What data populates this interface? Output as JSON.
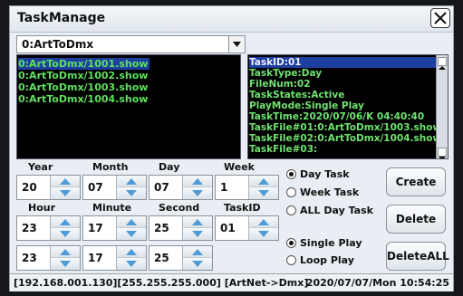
{
  "window": {
    "title": "TaskManage",
    "close_icon": "close-x-icon"
  },
  "task_selector": {
    "value": "0:ArtToDmx",
    "dropdown_icon": "triangle-down-icon"
  },
  "file_list": [
    "0:ArtToDmx/1001.show",
    "0:ArtToDmx/1002.show",
    "0:ArtToDmx/1003.show",
    "0:ArtToDmx/1004.show"
  ],
  "task_info": [
    "TaskID:01",
    "TaskType:Day",
    "FileNum:02",
    "TaskStates:Active",
    "PlayMode:Single Play",
    "TaskTime:2020/07/06/K 04:40:40",
    "TaskFile#01:0:ArtToDmx/1003.show",
    "TaskFile#02:0:ArtToDmx/1004.show",
    "TaskFile#03:"
  ],
  "fields": {
    "year": {
      "label": "Year",
      "value": "20"
    },
    "month": {
      "label": "Month",
      "value": "07"
    },
    "day": {
      "label": "Day",
      "value": "07"
    },
    "week": {
      "label": "Week",
      "value": "1"
    },
    "hour": {
      "label": "Hour",
      "value": "23"
    },
    "minute": {
      "label": "Minute",
      "value": "17"
    },
    "second": {
      "label": "Second",
      "value": "25"
    },
    "taskid": {
      "label": "TaskID",
      "value": "01"
    },
    "end_hour": {
      "value": "23"
    },
    "end_minute": {
      "value": "17"
    },
    "end_second": {
      "value": "25"
    }
  },
  "task_type": {
    "options": [
      "Day Task",
      "Week Task",
      "ALL Day Task"
    ],
    "selected": "Day Task"
  },
  "play_mode": {
    "options": [
      "Single Play",
      "Loop Play"
    ],
    "selected": "Single Play"
  },
  "buttons": {
    "create": "Create",
    "delete": "Delete",
    "delete_all": "DeleteALL"
  },
  "status": {
    "network": "[192.168.001.130][255.255.255.000] [ArtNet->Dmx]",
    "datetime": "2020/07/07/Mon 10:54:25"
  }
}
